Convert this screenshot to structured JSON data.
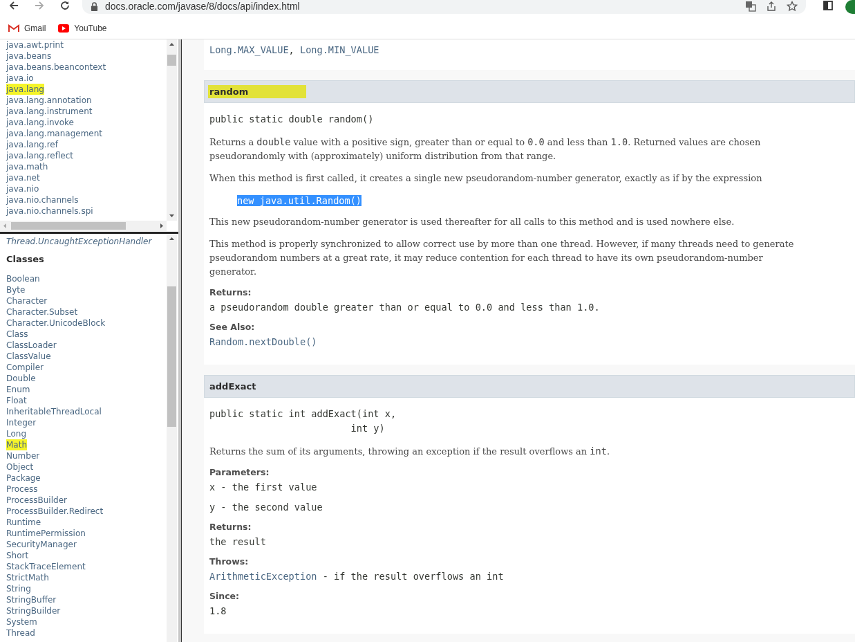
{
  "browser": {
    "url": "docs.oracle.com/javase/8/docs/api/index.html",
    "bookmarks": [
      {
        "label": "Gmail",
        "kind": "gmail"
      },
      {
        "label": "YouTube",
        "kind": "youtube"
      }
    ]
  },
  "packages": [
    {
      "name": "java.awt.print",
      "highlighted": false
    },
    {
      "name": "java.beans",
      "highlighted": false
    },
    {
      "name": "java.beans.beancontext",
      "highlighted": false
    },
    {
      "name": "java.io",
      "highlighted": false
    },
    {
      "name": "java.lang",
      "highlighted": true
    },
    {
      "name": "java.lang.annotation",
      "highlighted": false
    },
    {
      "name": "java.lang.instrument",
      "highlighted": false
    },
    {
      "name": "java.lang.invoke",
      "highlighted": false
    },
    {
      "name": "java.lang.management",
      "highlighted": false
    },
    {
      "name": "java.lang.ref",
      "highlighted": false
    },
    {
      "name": "java.lang.reflect",
      "highlighted": false
    },
    {
      "name": "java.math",
      "highlighted": false
    },
    {
      "name": "java.net",
      "highlighted": false
    },
    {
      "name": "java.nio",
      "highlighted": false
    },
    {
      "name": "java.nio.channels",
      "highlighted": false
    },
    {
      "name": "java.nio.channels.spi",
      "highlighted": false
    }
  ],
  "classes_frame": {
    "interface_item": "Thread.UncaughtExceptionHandler",
    "heading": "Classes",
    "items": [
      {
        "name": "Boolean",
        "highlighted": false
      },
      {
        "name": "Byte",
        "highlighted": false
      },
      {
        "name": "Character",
        "highlighted": false
      },
      {
        "name": "Character.Subset",
        "highlighted": false
      },
      {
        "name": "Character.UnicodeBlock",
        "highlighted": false
      },
      {
        "name": "Class",
        "highlighted": false
      },
      {
        "name": "ClassLoader",
        "highlighted": false
      },
      {
        "name": "ClassValue",
        "highlighted": false
      },
      {
        "name": "Compiler",
        "highlighted": false
      },
      {
        "name": "Double",
        "highlighted": false
      },
      {
        "name": "Enum",
        "highlighted": false
      },
      {
        "name": "Float",
        "highlighted": false
      },
      {
        "name": "InheritableThreadLocal",
        "highlighted": false
      },
      {
        "name": "Integer",
        "highlighted": false
      },
      {
        "name": "Long",
        "highlighted": false
      },
      {
        "name": "Math",
        "highlighted": true
      },
      {
        "name": "Number",
        "highlighted": false
      },
      {
        "name": "Object",
        "highlighted": false
      },
      {
        "name": "Package",
        "highlighted": false
      },
      {
        "name": "Process",
        "highlighted": false
      },
      {
        "name": "ProcessBuilder",
        "highlighted": false
      },
      {
        "name": "ProcessBuilder.Redirect",
        "highlighted": false
      },
      {
        "name": "Runtime",
        "highlighted": false
      },
      {
        "name": "RuntimePermission",
        "highlighted": false
      },
      {
        "name": "SecurityManager",
        "highlighted": false
      },
      {
        "name": "Short",
        "highlighted": false
      },
      {
        "name": "StackTraceElement",
        "highlighted": false
      },
      {
        "name": "StrictMath",
        "highlighted": false
      },
      {
        "name": "String",
        "highlighted": false
      },
      {
        "name": "StringBuffer",
        "highlighted": false
      },
      {
        "name": "StringBuilder",
        "highlighted": false
      },
      {
        "name": "System",
        "highlighted": false
      },
      {
        "name": "Thread",
        "highlighted": false
      }
    ]
  },
  "main": {
    "previous_tail": [
      {
        "t": "Long.MAX_VALUE",
        "link": true
      },
      {
        "t": ", ",
        "link": false
      },
      {
        "t": "Long.MIN_VALUE",
        "link": true
      }
    ],
    "methods": [
      {
        "name": "random",
        "highlighted": true,
        "signature": [
          "public static double random()"
        ],
        "blocks": [
          {
            "kind": "text",
            "segments": [
              {
                "t": "Returns a ",
                "mono": false
              },
              {
                "t": "double",
                "mono": true
              },
              {
                "t": " value with a positive sign, greater than or equal to ",
                "mono": false
              },
              {
                "t": "0.0",
                "mono": true
              },
              {
                "t": " and less than ",
                "mono": false
              },
              {
                "t": "1.0",
                "mono": true
              },
              {
                "t": ". Returned values are chosen pseudorandomly with (approximately) uniform distribution from that range.",
                "mono": false
              }
            ]
          },
          {
            "kind": "text",
            "segments": [
              {
                "t": "When this method is first called, it creates a single new pseudorandom-number generator, exactly as if by the expression",
                "mono": false
              }
            ]
          },
          {
            "kind": "example",
            "text": "new java.util.Random()",
            "selected": true
          },
          {
            "kind": "text",
            "segments": [
              {
                "t": "This new pseudorandom-number generator is used thereafter for all calls to this method and is used nowhere else.",
                "mono": false
              }
            ]
          },
          {
            "kind": "text",
            "segments": [
              {
                "t": "This method is properly synchronized to allow correct use by more than one thread. However, if many threads need to generate pseudorandom numbers at a great rate, it may reduce contention for each thread to have its own pseudorandom-number generator.",
                "mono": false
              }
            ]
          },
          {
            "kind": "label",
            "text": "Returns:"
          },
          {
            "kind": "code",
            "segments": [
              {
                "t": "a pseudorandom double greater than or equal to 0.0 and less than 1.0.",
                "link": false
              }
            ]
          },
          {
            "kind": "label",
            "text": "See Also:"
          },
          {
            "kind": "code",
            "segments": [
              {
                "t": "Random.nextDouble()",
                "link": true
              }
            ]
          }
        ]
      },
      {
        "name": "addExact",
        "highlighted": false,
        "signature": [
          "public static int addExact(int x,",
          "                         int y)"
        ],
        "blocks": [
          {
            "kind": "text",
            "segments": [
              {
                "t": "Returns the sum of its arguments, throwing an exception if the result overflows an ",
                "mono": false
              },
              {
                "t": "int",
                "mono": true
              },
              {
                "t": ".",
                "mono": false
              }
            ]
          },
          {
            "kind": "label",
            "text": "Parameters:"
          },
          {
            "kind": "code",
            "segments": [
              {
                "t": "x - the first value",
                "link": false
              }
            ]
          },
          {
            "kind": "code",
            "segments": [
              {
                "t": "y - the second value",
                "link": false
              }
            ]
          },
          {
            "kind": "label",
            "text": "Returns:"
          },
          {
            "kind": "code",
            "segments": [
              {
                "t": "the result",
                "link": false
              }
            ]
          },
          {
            "kind": "label",
            "text": "Throws:"
          },
          {
            "kind": "code",
            "segments": [
              {
                "t": "ArithmeticException",
                "link": true
              },
              {
                "t": " - if the result overflows an int",
                "link": false
              }
            ]
          },
          {
            "kind": "label",
            "text": "Since:"
          },
          {
            "kind": "code",
            "segments": [
              {
                "t": "1.8",
                "link": false
              }
            ]
          }
        ]
      }
    ]
  }
}
